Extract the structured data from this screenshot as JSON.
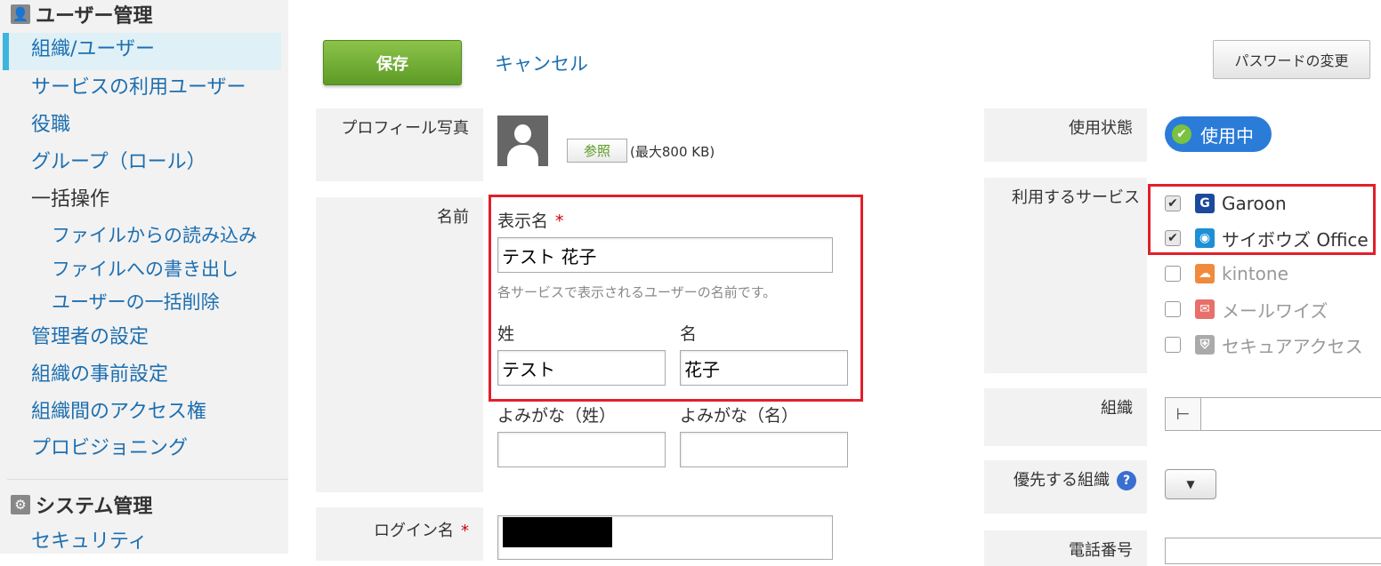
{
  "sidebar": {
    "user_mgmt_header": "ユーザー管理",
    "items": [
      {
        "label": "組織/ユーザー"
      },
      {
        "label": "サービスの利用ユーザー"
      },
      {
        "label": "役職"
      },
      {
        "label": "グループ（ロール）"
      },
      {
        "label": "一括操作"
      },
      {
        "label": "ファイルからの読み込み"
      },
      {
        "label": "ファイルへの書き出し"
      },
      {
        "label": "ユーザーの一括削除"
      },
      {
        "label": "管理者の設定"
      },
      {
        "label": "組織の事前設定"
      },
      {
        "label": "組織間のアクセス権"
      },
      {
        "label": "プロビジョニング"
      }
    ],
    "system_mgmt_header": "システム管理",
    "system_items": [
      {
        "label": "セキュリティ"
      }
    ]
  },
  "toolbar": {
    "save_label": "保存",
    "cancel_label": "キャンセル",
    "password_label": "パスワードの変更"
  },
  "form": {
    "profile_photo_label": "プロフィール写真",
    "browse_label": "参照",
    "max_size": "(最大800 KB)",
    "name_label": "名前",
    "display_name_label": "表示名",
    "required_mark": "*",
    "display_name_value": "テスト 花子",
    "display_name_hint": "各サービスで表示されるユーザーの名前です。",
    "last_name_label": "姓",
    "first_name_label": "名",
    "last_name_value": "テスト",
    "first_name_value": "花子",
    "last_kana_label": "よみがな（姓）",
    "first_kana_label": "よみがな（名）",
    "last_kana_value": "",
    "first_kana_value": "",
    "login_label": "ログイン名"
  },
  "right": {
    "status_label": "使用状態",
    "status_value": "使用中",
    "services_label": "利用するサービス",
    "services": [
      {
        "name": "Garoon",
        "checked": true,
        "icon": "garoon-icon",
        "color": "#1b4a9c"
      },
      {
        "name": "サイボウズ Office",
        "checked": true,
        "icon": "cybozu-office-icon",
        "color": "#1c8fd6"
      },
      {
        "name": "kintone",
        "checked": false,
        "icon": "kintone-icon",
        "color": "#f08a3c"
      },
      {
        "name": "メールワイズ",
        "checked": false,
        "icon": "mailwise-icon",
        "color": "#e8706a"
      },
      {
        "name": "セキュアアクセス",
        "checked": false,
        "icon": "secure-access-icon",
        "color": "#aaaaaa"
      }
    ],
    "org_label": "組織",
    "priority_org_label": "優先する組織",
    "help_glyph": "?",
    "phone_label": "電話番号"
  },
  "colors": {
    "accent_blue": "#1d6fb0",
    "save_green": "#6aab2e",
    "highlight_red": "#e0202a",
    "sidebar_active": "#dff1f6"
  }
}
